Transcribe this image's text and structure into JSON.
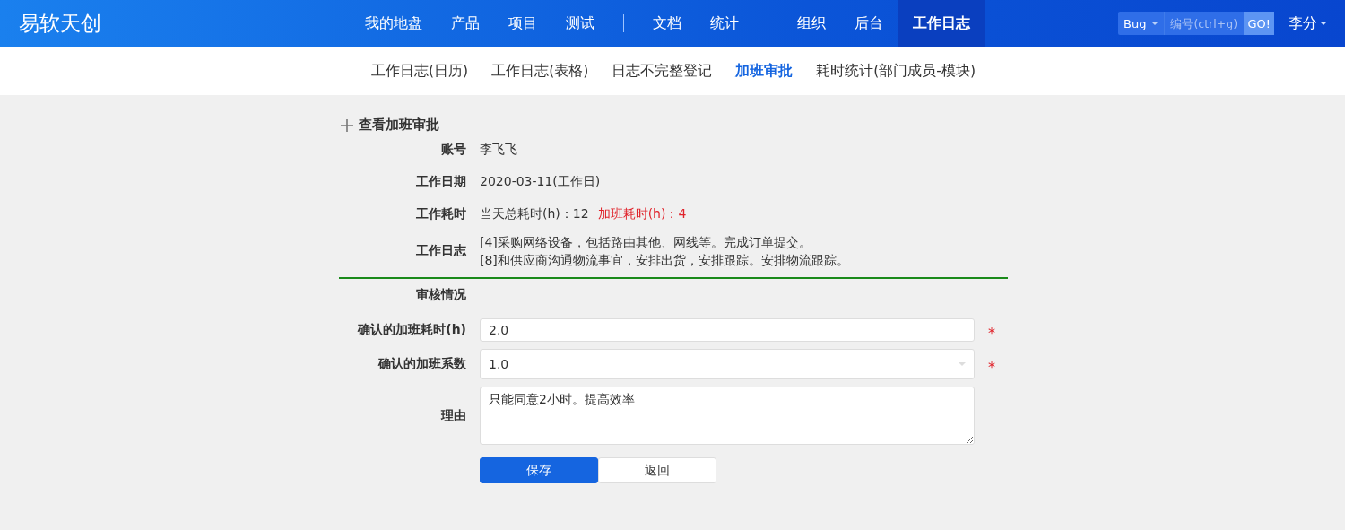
{
  "brand": "易软天创",
  "nav_groups": [
    [
      {
        "label": "我的地盘",
        "selected": false
      },
      {
        "label": "产品",
        "selected": false
      },
      {
        "label": "项目",
        "selected": false
      },
      {
        "label": "测试",
        "selected": false
      }
    ],
    [
      {
        "label": "文档",
        "selected": false
      },
      {
        "label": "统计",
        "selected": false
      }
    ],
    [
      {
        "label": "组织",
        "selected": false
      },
      {
        "label": "后台",
        "selected": false
      },
      {
        "label": "工作日志",
        "selected": true
      }
    ]
  ],
  "search": {
    "type": "Bug",
    "placeholder": "编号(ctrl+g)",
    "button": "GO!"
  },
  "user": "李分",
  "subnav": [
    {
      "label": "工作日志(日历)",
      "selected": false
    },
    {
      "label": "工作日志(表格)",
      "selected": false
    },
    {
      "label": "日志不完整登记",
      "selected": false
    },
    {
      "label": "加班审批",
      "selected": true
    },
    {
      "label": "耗时统计(部门成员-模块)",
      "selected": false
    }
  ],
  "panel_title": "查看加班审批",
  "details": [
    {
      "label": "账号",
      "parts": [
        {
          "text": "李飞飞",
          "kind": "normal"
        }
      ]
    },
    {
      "label": "工作日期",
      "parts": [
        {
          "text": "2020-03-11(工作日)",
          "kind": "normal"
        }
      ]
    },
    {
      "label": "工作耗时",
      "parts": [
        {
          "text": "当天总耗时(h)：12",
          "kind": "normal"
        },
        {
          "text": "加班耗时(h)：4",
          "kind": "alert"
        }
      ]
    },
    {
      "label": "工作日志",
      "lines": [
        "[4]采购网络设备，包括路由其他、网线等。完成订单提交。",
        "[8]和供应商沟通物流事宜，安排出货，安排跟踪。安排物流跟踪。"
      ]
    }
  ],
  "review_title": "审核情况",
  "required_mark": "*",
  "fields": [
    {
      "label": "确认的加班耗时(h)",
      "kind": "input",
      "value": "2.0",
      "required": true
    },
    {
      "label": "确认的加班系数",
      "kind": "select",
      "value": "1.0",
      "required": true
    },
    {
      "label": "理由",
      "kind": "textarea",
      "value": "只能同意2小时。提高效率",
      "required": false
    }
  ],
  "buttons": [
    {
      "label": "保存",
      "kind": "primary"
    },
    {
      "label": "返回",
      "kind": "default"
    }
  ]
}
